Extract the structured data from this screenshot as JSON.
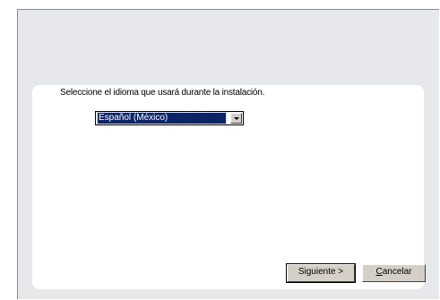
{
  "prompt": "Seleccione el idioma que usará durante la instalación.",
  "language_select": {
    "value": "Español (México)"
  },
  "buttons": {
    "next_label": "Siguiente >",
    "cancel_mnemonic": "C",
    "cancel_rest": "ancelar"
  },
  "icons": {
    "dropdown": "chevron-down-icon"
  },
  "colors": {
    "selection": "#0a246a",
    "window_bg": "#e7e8ec",
    "button_face": "#d4d0c8"
  }
}
